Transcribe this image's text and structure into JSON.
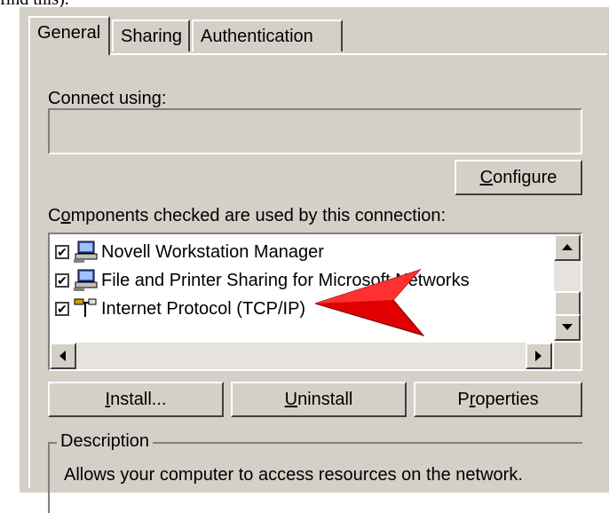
{
  "header_fragment": "find this).",
  "tabs": [
    {
      "label": "General"
    },
    {
      "label": "Sharing"
    },
    {
      "label": "Authentication"
    }
  ],
  "connect": {
    "label": "Connect using:",
    "value": ""
  },
  "configure_button": {
    "prefix": "",
    "accel": "C",
    "suffix": "onfigure"
  },
  "components": {
    "label_prefix": "C",
    "label_accel": "o",
    "label_suffix": "mponents checked are used by this connection:",
    "items": [
      {
        "label": "Novell Workstation Manager",
        "checked": true,
        "icon": "network-computer-icon"
      },
      {
        "label": "File and Printer Sharing for Microsoft Networks",
        "checked": true,
        "icon": "network-computer-icon"
      },
      {
        "label": "Internet Protocol (TCP/IP)",
        "checked": true,
        "icon": "protocol-plug-icon"
      }
    ]
  },
  "buttons": {
    "install": {
      "accel": "I",
      "suffix": "nstall..."
    },
    "uninstall": {
      "accel": "U",
      "suffix": "ninstall"
    },
    "properties": {
      "prefix": "P",
      "accel": "r",
      "suffix": "operties"
    }
  },
  "description": {
    "title": "Description",
    "text": "Allows your computer to access resources on the network."
  },
  "colors": {
    "dialog": "#d4d0c8",
    "arrow": "#e00000"
  }
}
